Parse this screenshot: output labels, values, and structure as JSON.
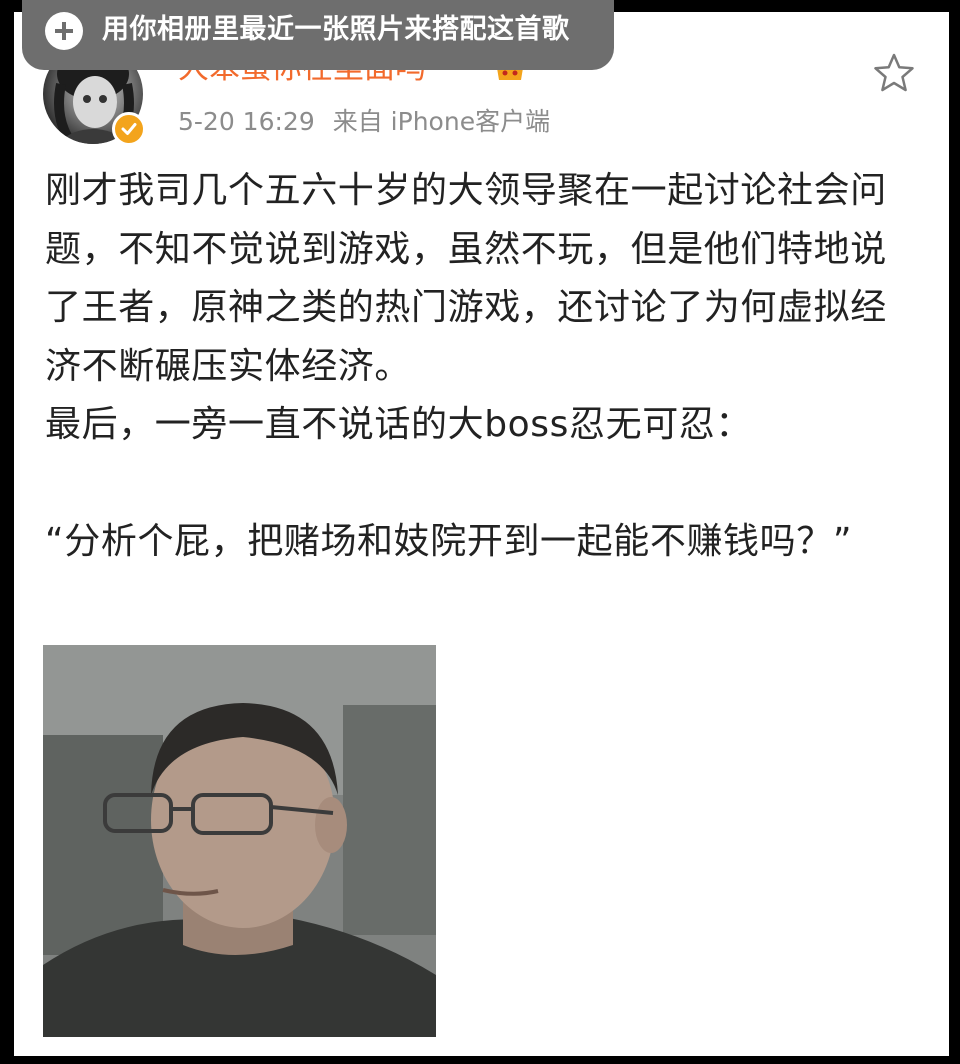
{
  "toast": {
    "icon": "plus-circle-icon",
    "text": "用你相册里最近一张照片来搭配这首歌"
  },
  "post": {
    "username": "大笨蛋你在里面吗",
    "time": "5-20 16:29",
    "source": "来自 iPhone客户端",
    "paragraphs": [
      "刚才我司几个五六十岁的大领导聚在一起讨论社会问题，不知不觉说到游戏，虽然不玩，但是他们特地说了王者，原神之类的热门游戏，还讨论了为何虚拟经济不断碾压实体经济。",
      "最后，一旁一直不说话的大boss忍无可忍：",
      "“分析个屁，把赌场和妓院开到一起能不赚钱吗？”"
    ]
  },
  "colors": {
    "username": "#f26a2c",
    "verified": "#f3a41c",
    "meta": "#8c8c8c",
    "toast_bg": "#6e6e6e"
  }
}
